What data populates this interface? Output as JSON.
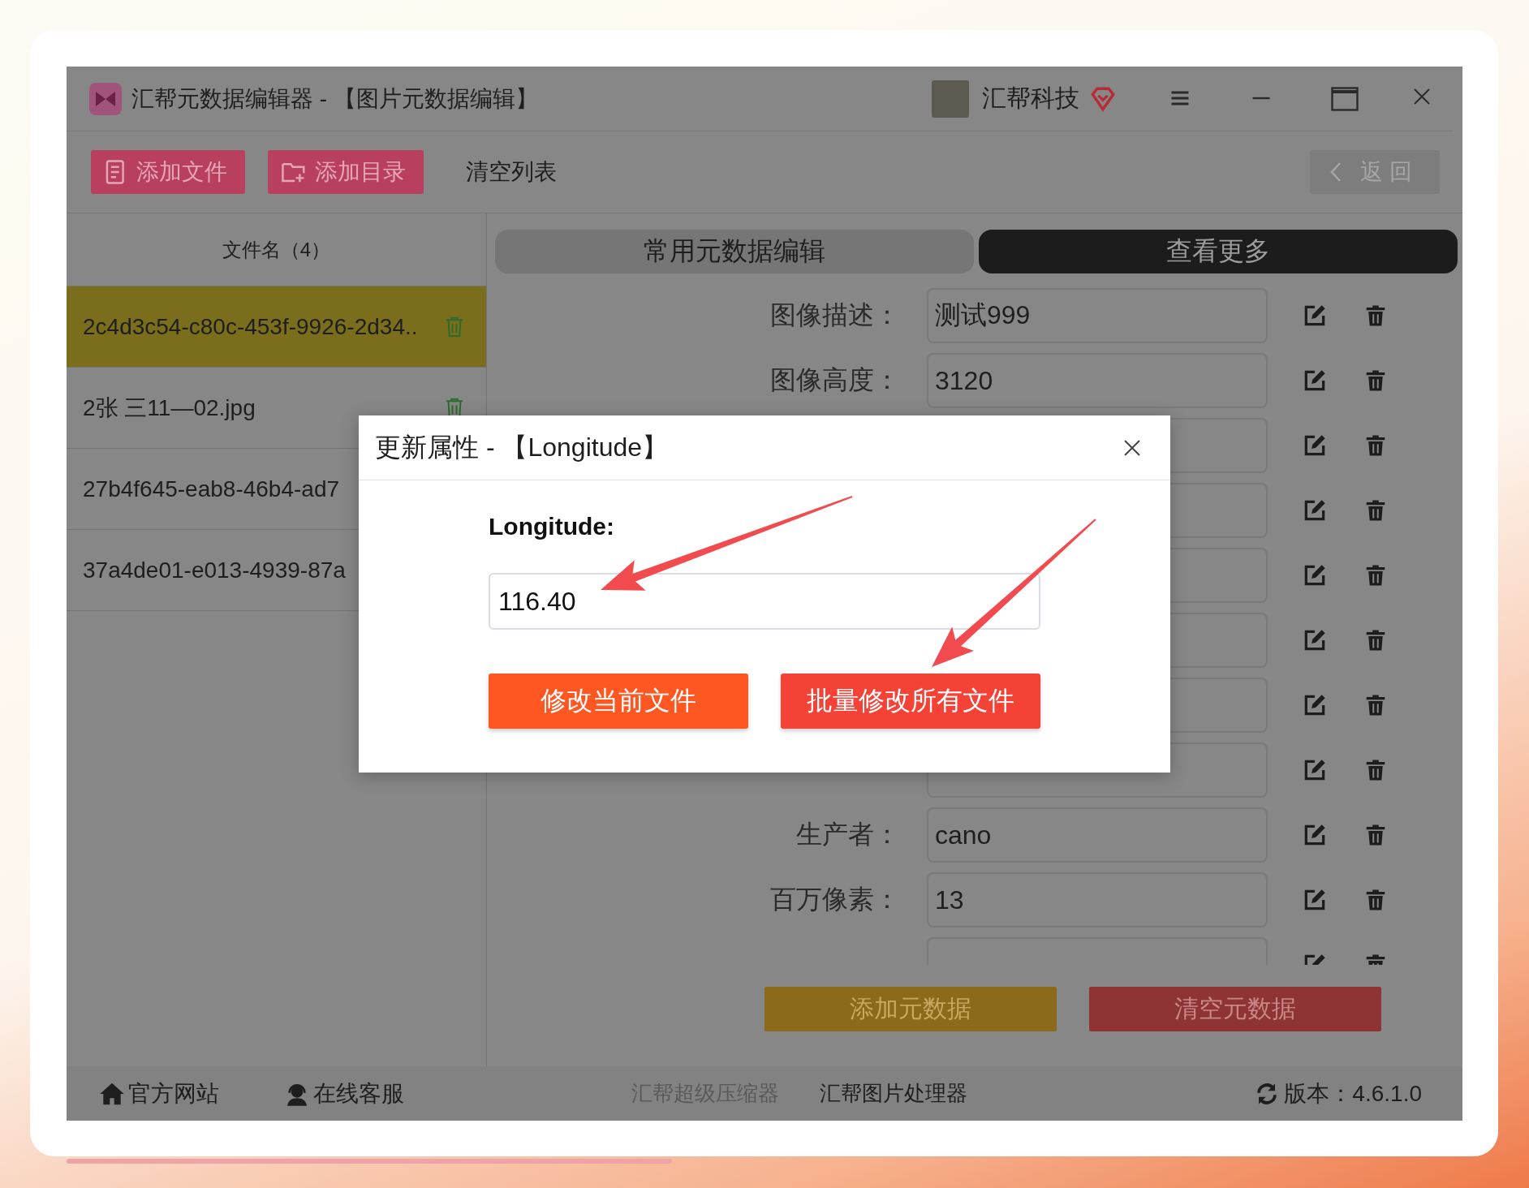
{
  "window": {
    "title": "汇帮元数据编辑器 - 【图片元数据编辑】",
    "user_name": "汇帮科技"
  },
  "toolbar": {
    "buttons": [
      {
        "label": "添加文件",
        "kind": "file"
      },
      {
        "label": "添加目录",
        "kind": "folder"
      },
      {
        "label": "清空列表",
        "kind": "text"
      }
    ],
    "back_button": "返 回"
  },
  "file_list": {
    "header": "文件名（4）",
    "items": [
      {
        "name": "2c4d3c54-c80c-453f-9926-2d34..",
        "selected": true
      },
      {
        "name": "2张 三11—02.jpg",
        "selected": false
      },
      {
        "name": "27b4f645-eab8-46b4-ad7",
        "selected": false
      },
      {
        "name": "37a4de01-e013-4939-87a",
        "selected": false
      }
    ]
  },
  "tabs": [
    {
      "label": "常用元数据编辑",
      "selected": false
    },
    {
      "label": "查看更多",
      "selected": true
    }
  ],
  "fields": [
    {
      "kind": "text",
      "label": "图像描述：",
      "value": "测试999"
    },
    {
      "kind": "text",
      "label": "图像高度：",
      "value": "3120"
    },
    {
      "kind": "covered"
    },
    {
      "kind": "covered"
    },
    {
      "kind": "covered"
    },
    {
      "kind": "covered"
    },
    {
      "kind": "covered"
    },
    {
      "kind": "covered"
    },
    {
      "kind": "text",
      "label": "生产者：",
      "value": "cano"
    },
    {
      "kind": "text",
      "label": "百万像素：",
      "value": "13"
    },
    {
      "kind": "covered"
    }
  ],
  "actions": [
    {
      "label": "添加元数据",
      "kind": "add"
    },
    {
      "label": "清空元数据",
      "kind": "clear"
    }
  ],
  "status_bar": {
    "links": [
      {
        "label": "官方网站",
        "kind": "home"
      },
      {
        "label": "在线客服",
        "kind": "support"
      }
    ],
    "products": [
      {
        "label": "汇帮超级压缩器",
        "disabled": true
      },
      {
        "label": "汇帮图片处理器",
        "disabled": false
      }
    ],
    "version": "版本：4.6.1.0"
  },
  "dialog": {
    "title": "更新属性 - 【Longitude】",
    "field_label": "Longitude:",
    "value": "116.40",
    "buttons": [
      {
        "label": "修改当前文件",
        "kind": "current"
      },
      {
        "label": "批量修改所有文件",
        "kind": "batch"
      }
    ]
  }
}
